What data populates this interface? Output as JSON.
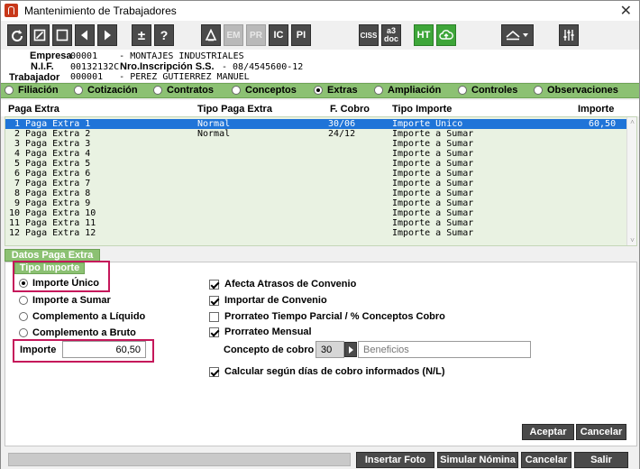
{
  "window": {
    "title": "Mantenimiento de Trabajadores"
  },
  "toolbar": {
    "plus_minus": "±",
    "help": "?",
    "em": "EM",
    "pr": "PR",
    "ic": "IC",
    "pi": "PI",
    "ciss": "CISS",
    "a3doc_line1": "a3",
    "a3doc_line2": "doc",
    "ht": "HT"
  },
  "header": {
    "empresa_label": "Empresa",
    "empresa_value": "00001    - MONTAJES INDUSTRIALES",
    "nif_label": "N.I.F.",
    "nif_value": "00132132C",
    "inscripcion_label": "Nro.Inscripción S.S.",
    "inscripcion_value": "- 08/4545600-12",
    "trabajador_label": "Trabajador",
    "trabajador_value": "000001   - PEREZ GUTIERREZ MANUEL"
  },
  "tabs": [
    {
      "label": "Filiación",
      "selected": false
    },
    {
      "label": "Cotización",
      "selected": false
    },
    {
      "label": "Contratos",
      "selected": false
    },
    {
      "label": "Conceptos",
      "selected": false
    },
    {
      "label": "Extras",
      "selected": true
    },
    {
      "label": "Ampliación",
      "selected": false
    },
    {
      "label": "Controles",
      "selected": false
    },
    {
      "label": "Observaciones",
      "selected": false
    }
  ],
  "grid": {
    "columns": [
      "Paga Extra",
      "Tipo Paga Extra",
      "F. Cobro",
      "Tipo Importe",
      "Importe"
    ],
    "rows": [
      {
        "paga": " 1 Paga Extra 1",
        "tipo": "Normal",
        "fecha": "30/06",
        "tipo_importe": "Importe Unico",
        "importe": "60,50",
        "selected": true
      },
      {
        "paga": " 2 Paga Extra 2",
        "tipo": "Normal",
        "fecha": "24/12",
        "tipo_importe": "Importe a Sumar",
        "importe": ""
      },
      {
        "paga": " 3 Paga Extra 3",
        "tipo": "",
        "fecha": "",
        "tipo_importe": "Importe a Sumar",
        "importe": ""
      },
      {
        "paga": " 4 Paga Extra 4",
        "tipo": "",
        "fecha": "",
        "tipo_importe": "Importe a Sumar",
        "importe": ""
      },
      {
        "paga": " 5 Paga Extra 5",
        "tipo": "",
        "fecha": "",
        "tipo_importe": "Importe a Sumar",
        "importe": ""
      },
      {
        "paga": " 6 Paga Extra 6",
        "tipo": "",
        "fecha": "",
        "tipo_importe": "Importe a Sumar",
        "importe": ""
      },
      {
        "paga": " 7 Paga Extra 7",
        "tipo": "",
        "fecha": "",
        "tipo_importe": "Importe a Sumar",
        "importe": ""
      },
      {
        "paga": " 8 Paga Extra 8",
        "tipo": "",
        "fecha": "",
        "tipo_importe": "Importe a Sumar",
        "importe": ""
      },
      {
        "paga": " 9 Paga Extra 9",
        "tipo": "",
        "fecha": "",
        "tipo_importe": "Importe a Sumar",
        "importe": ""
      },
      {
        "paga": "10 Paga Extra 10",
        "tipo": "",
        "fecha": "",
        "tipo_importe": "Importe a Sumar",
        "importe": ""
      },
      {
        "paga": "11 Paga Extra 11",
        "tipo": "",
        "fecha": "",
        "tipo_importe": "Importe a Sumar",
        "importe": ""
      },
      {
        "paga": "12 Paga Extra 12",
        "tipo": "",
        "fecha": "",
        "tipo_importe": "Importe a Sumar",
        "importe": ""
      }
    ]
  },
  "details": {
    "panel_title": "Datos Paga Extra",
    "tipo_importe_title": "Tipo Importe",
    "options": [
      {
        "label": "Importe Único",
        "selected": true
      },
      {
        "label": "Importe a Sumar",
        "selected": false
      },
      {
        "label": "Complemento a Líquido",
        "selected": false
      },
      {
        "label": "Complemento a Bruto",
        "selected": false
      }
    ],
    "importe_label": "Importe",
    "importe_value": "60,50",
    "checks": [
      {
        "label": "Afecta Atrasos de Convenio",
        "checked": true
      },
      {
        "label": "Importar de Convenio",
        "checked": true
      },
      {
        "label": "Prorrateo Tiempo Parcial / % Conceptos Cobro",
        "checked": false
      },
      {
        "label": "Prorrateo Mensual",
        "checked": true
      }
    ],
    "concepto_label": "Concepto de cobro",
    "concepto_code": "30",
    "concepto_desc": "Beneficios",
    "calcular_label": "Calcular según días de cobro informados (N/L)",
    "calcular_checked": true,
    "aceptar": "Aceptar",
    "cancelar": "Cancelar"
  },
  "footer": {
    "insertar_foto": "Insertar Foto",
    "simular_nomina": "Simular Nómina",
    "cancelar": "Cancelar",
    "salir": "Salir"
  },
  "colors": {
    "accent_green": "#8cc173",
    "selection_blue": "#1f74d8",
    "highlight_magenta": "#c5175a",
    "button_dark": "#4a4a4a"
  }
}
